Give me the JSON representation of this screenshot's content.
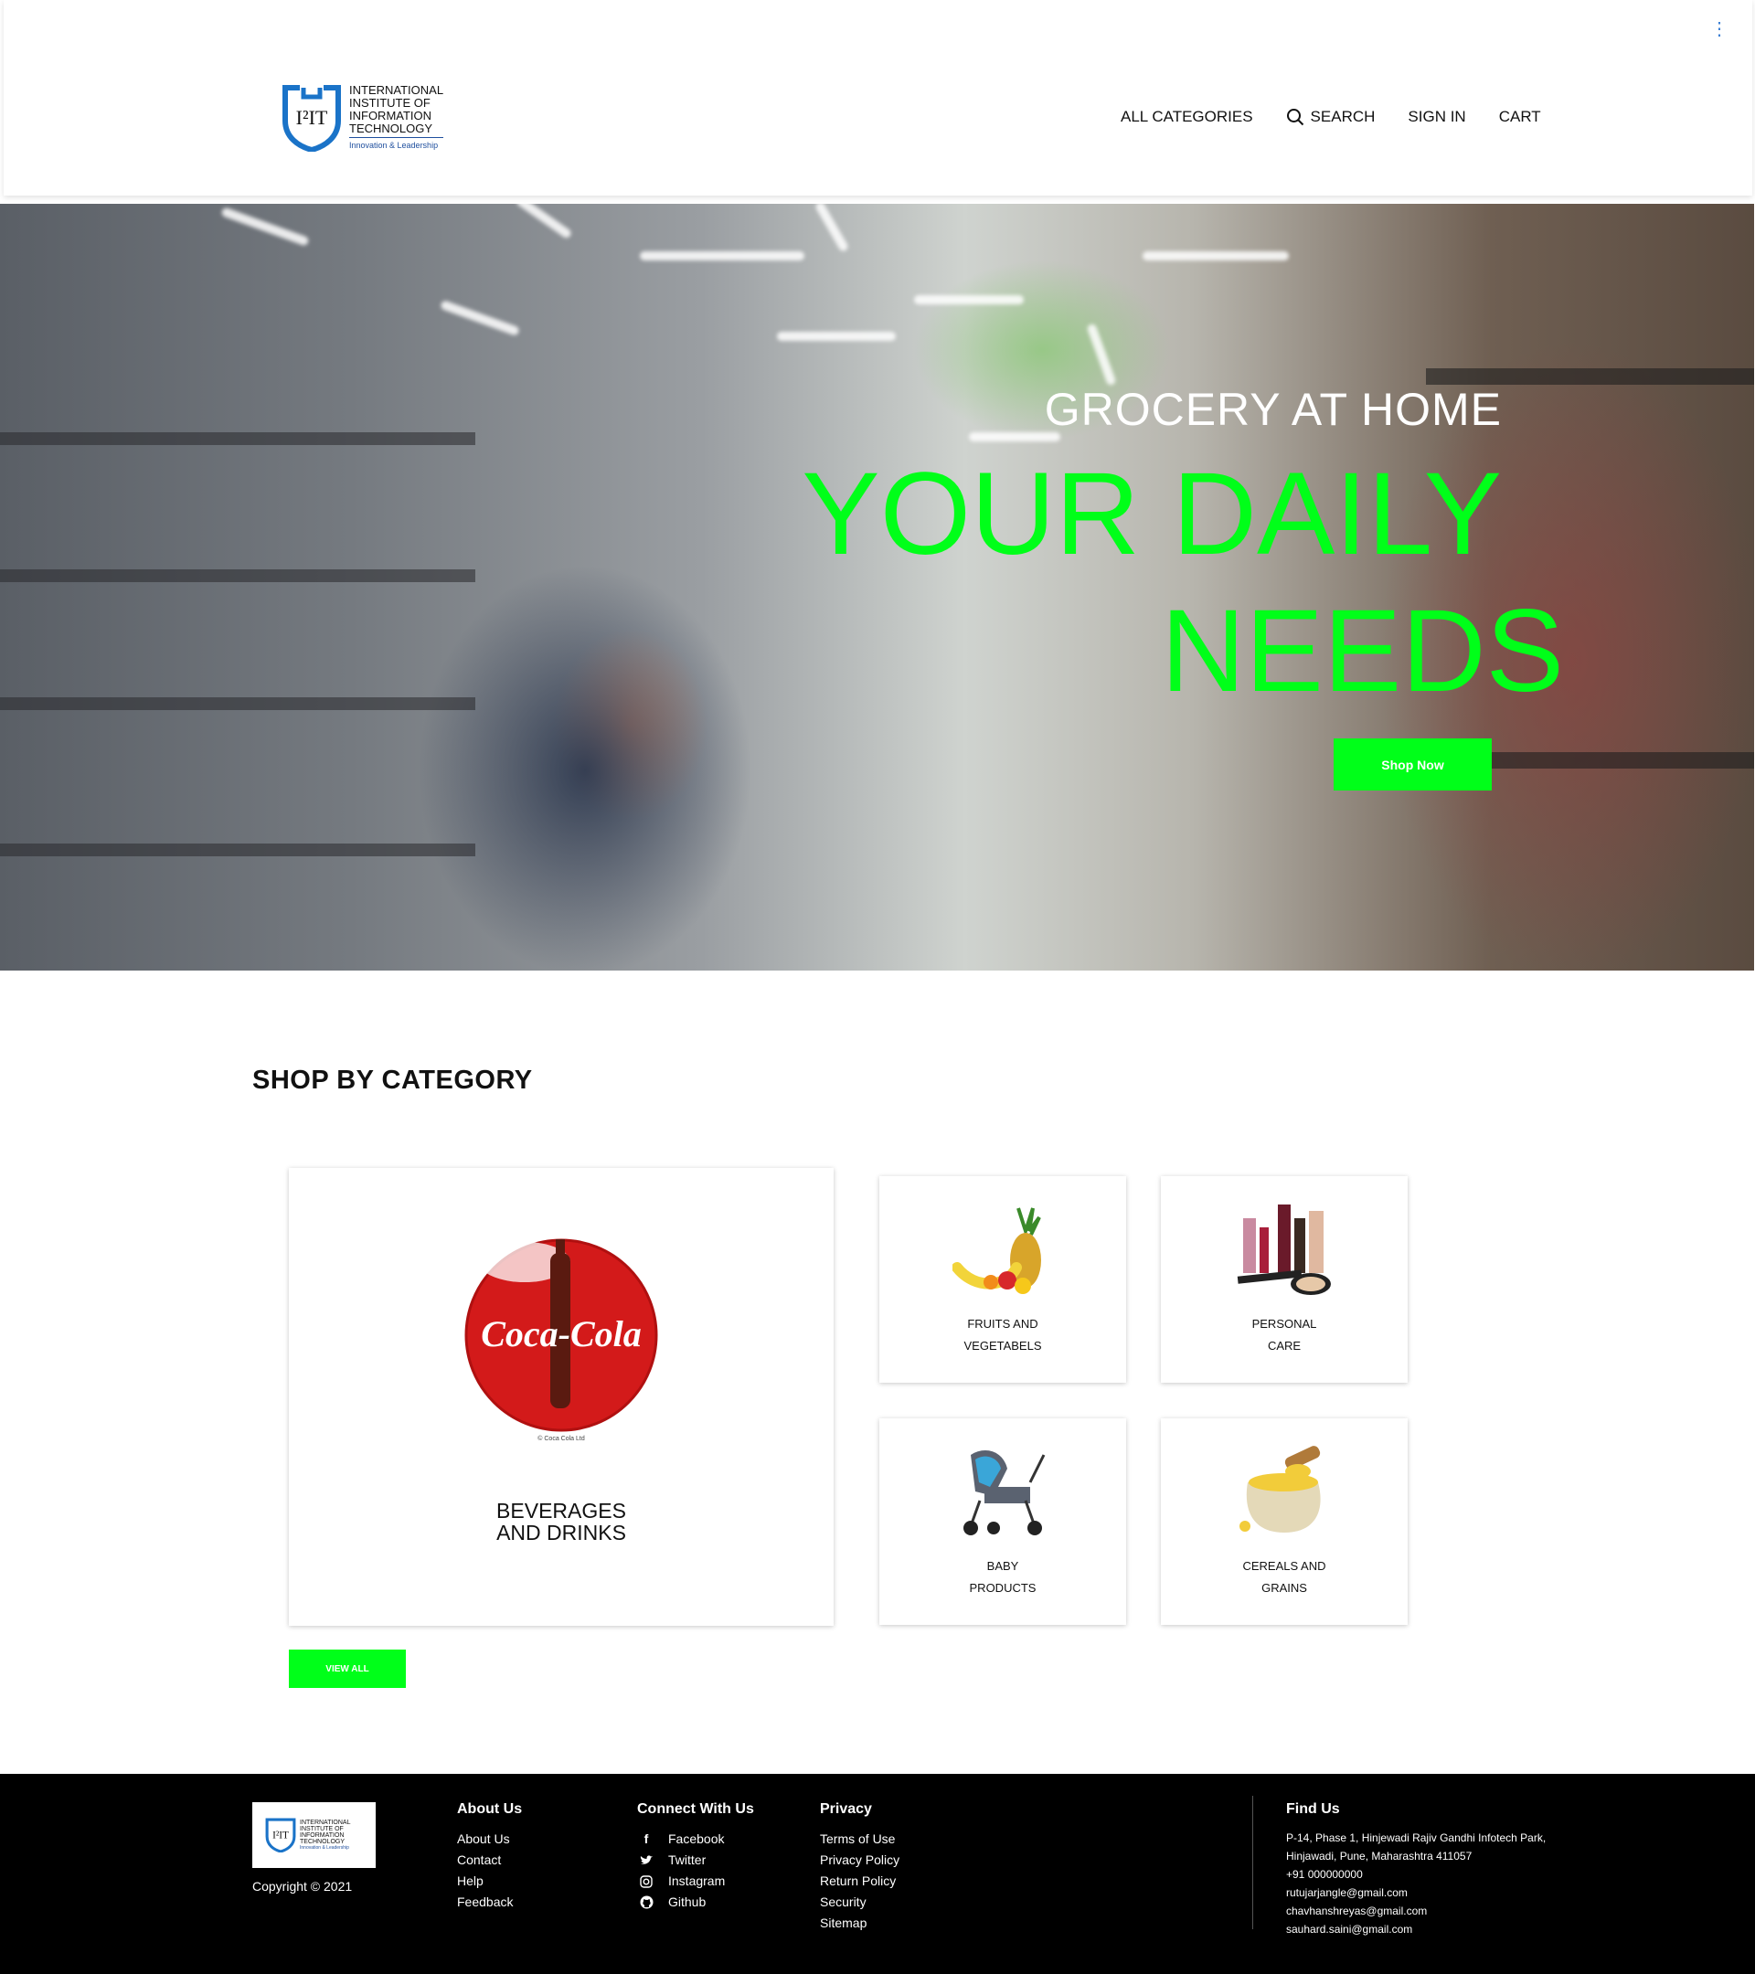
{
  "header": {
    "logo": {
      "line1": "INTERNATIONAL",
      "line2": "INSTITUTE OF",
      "line3": "INFORMATION",
      "line4": "TECHNOLOGY",
      "tagline": "Innovation & Leadership",
      "mark": "I²IT"
    },
    "nav": {
      "all_categories": "ALL CATEGORIES",
      "search": "SEARCH",
      "sign_in": "SIGN IN",
      "cart": "CART"
    },
    "menu_icon": "kebab-menu-icon"
  },
  "hero": {
    "subtitle": "GROCERY AT HOME",
    "title_line1": "YOUR DAILY",
    "title_line2": "NEEDS",
    "cta": "Shop Now",
    "accent_color": "#00ff19"
  },
  "categories": {
    "title": "SHOP BY CATEGORY",
    "featured": {
      "line1": "BEVERAGES",
      "line2": "AND DRINKS",
      "image": "coca-cola-logo"
    },
    "items": [
      {
        "line1": "FRUITS AND",
        "line2": "VEGETABELS",
        "image": "fruits"
      },
      {
        "line1": "PERSONAL",
        "line2": "CARE",
        "image": "cosmetics"
      },
      {
        "line1": "BABY",
        "line2": "PRODUCTS",
        "image": "stroller"
      },
      {
        "line1": "CEREALS AND",
        "line2": "GRAINS",
        "image": "grain-sack"
      }
    ],
    "view_all": "VIEW ALL"
  },
  "footer": {
    "copyright": "Copyright © 2021",
    "about": {
      "title": "About Us",
      "links": [
        "About Us",
        "Contact",
        "Help",
        "Feedback"
      ]
    },
    "connect": {
      "title": "Connect With Us",
      "links": [
        "Facebook",
        "Twitter",
        "Instagram",
        "Github"
      ]
    },
    "privacy": {
      "title": "Privacy",
      "links": [
        "Terms of Use",
        "Privacy Policy",
        "Return Policy",
        "Security",
        "Sitemap"
      ]
    },
    "find": {
      "title": "Find Us",
      "address1": "P-14, Phase 1, Hinjewadi Rajiv Gandhi Infotech Park,",
      "address2": "Hinjawadi, Pune, Maharashtra 411057",
      "phone": "+91 000000000",
      "emails": [
        "rutujarjangle@gmail.com",
        "chavhanshreyas@gmail.com",
        "sauhard.saini@gmail.com"
      ]
    }
  }
}
